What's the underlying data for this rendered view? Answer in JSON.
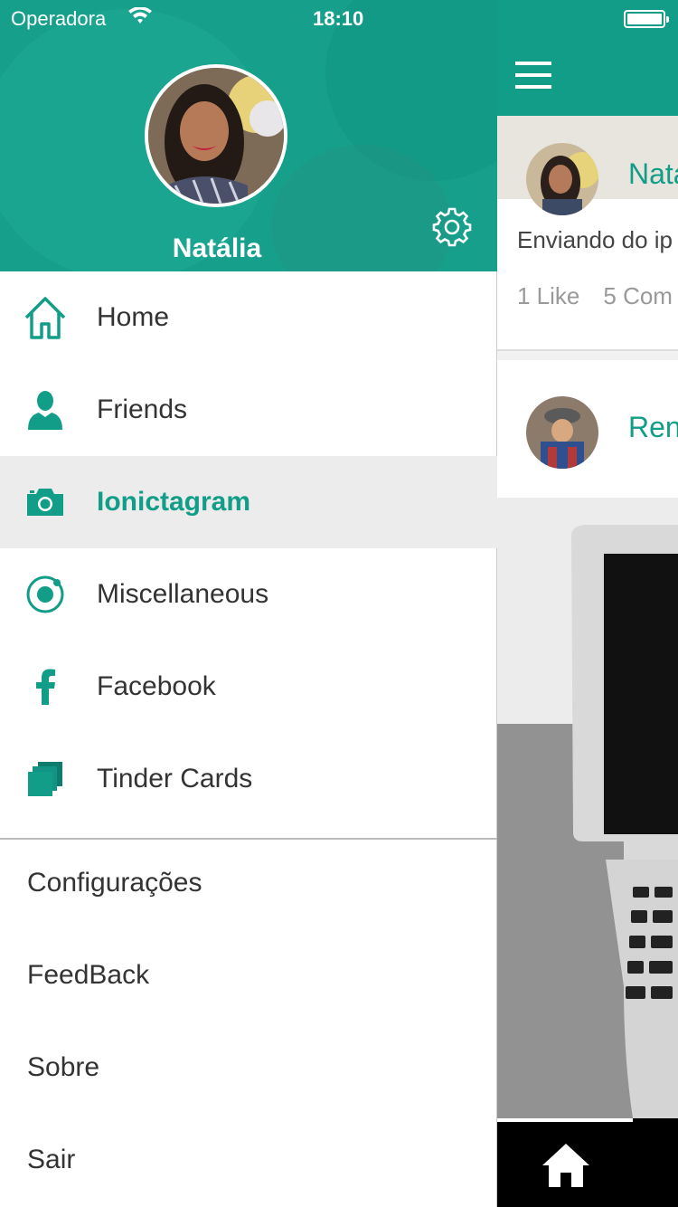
{
  "colors": {
    "accent": "#129d89",
    "header": "#16a08c",
    "active_row": "#ececec",
    "tabbar": "#000000"
  },
  "statusbar": {
    "carrier": "Operadora",
    "time": "18:10"
  },
  "profile": {
    "name": "Natália"
  },
  "menu": {
    "items": [
      {
        "label": "Home",
        "icon": "home-icon",
        "active": false
      },
      {
        "label": "Friends",
        "icon": "person-icon",
        "active": false
      },
      {
        "label": "Ionictagram",
        "icon": "camera-icon",
        "active": true
      },
      {
        "label": "Miscellaneous",
        "icon": "ionic-icon",
        "active": false
      },
      {
        "label": "Facebook",
        "icon": "facebook-icon",
        "active": false
      },
      {
        "label": "Tinder Cards",
        "icon": "cards-icon",
        "active": false
      }
    ],
    "secondary": [
      {
        "label": "Configurações"
      },
      {
        "label": "FeedBack"
      },
      {
        "label": "Sobre"
      },
      {
        "label": "Sair"
      }
    ]
  },
  "feed": {
    "posts": [
      {
        "name": "Nata",
        "text": "Enviando do ip",
        "likes": "1 Like",
        "comments": "5 Com"
      },
      {
        "name": "Ren"
      }
    ]
  }
}
